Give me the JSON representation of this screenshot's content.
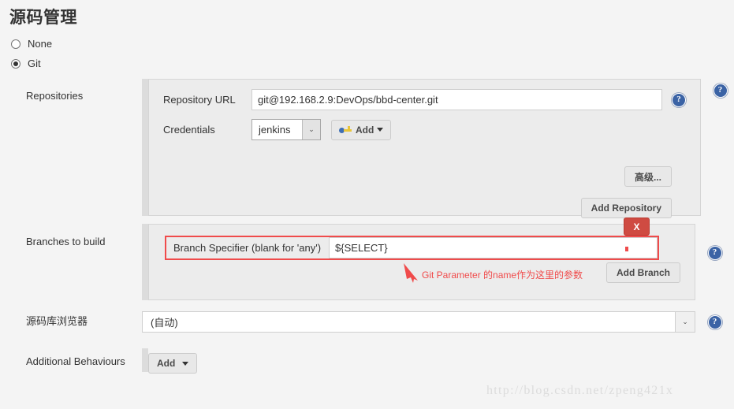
{
  "page": {
    "title": "源码管理",
    "watermark": "http://blog.csdn.net/zpeng421x"
  },
  "scm_types": [
    {
      "label": "None",
      "selected": false
    },
    {
      "label": "Git",
      "selected": true
    }
  ],
  "repositories": {
    "section_label": "Repositories",
    "repository_url": {
      "label": "Repository URL",
      "value": "git@192.168.2.9:DevOps/bbd-center.git",
      "placeholder": ""
    },
    "credentials": {
      "label": "Credentials",
      "value": "jenkins",
      "arrow": "⌄"
    },
    "add_credentials_button": "Add",
    "advanced_button": "高级...",
    "add_repository_button": "Add Repository",
    "help": "?"
  },
  "branches": {
    "section_label": "Branches to build",
    "branch_specifier": {
      "label": "Branch Specifier (blank for 'any')",
      "value": "${SELECT}",
      "placeholder": ""
    },
    "delete_button": "X",
    "add_branch_button": "Add Branch",
    "annotation": "Git Parameter 的name作为这里的参数",
    "help": "?"
  },
  "repository_browser": {
    "label": "源码库浏览器",
    "value": "(自动)",
    "arrow": "⌄",
    "help": "?"
  },
  "additional_behaviours": {
    "label": "Additional Behaviours",
    "add_button": "Add",
    "caret": "▼"
  },
  "colors": {
    "accent_red": "#f04b4b",
    "delete_red": "#cf4b42",
    "help_blue": "#3b63a5",
    "panel_bg": "#ececec",
    "page_bg": "#f4f4f4"
  }
}
